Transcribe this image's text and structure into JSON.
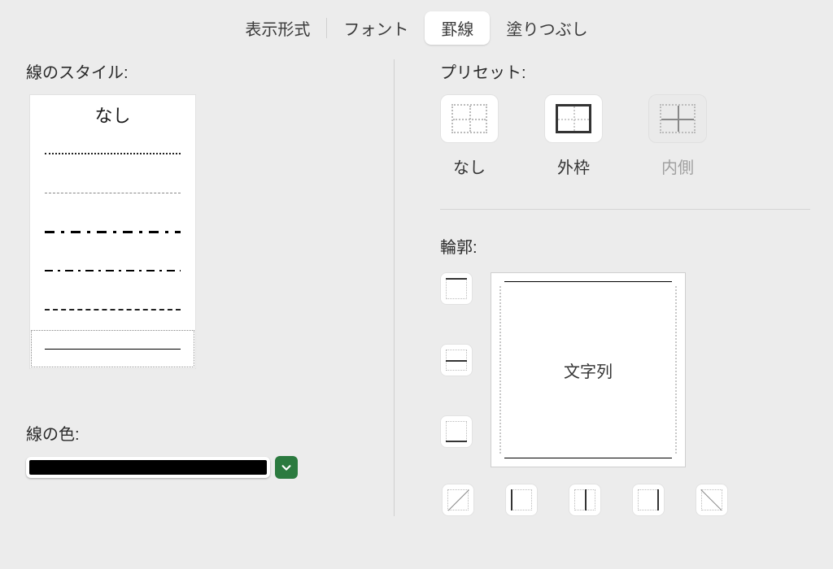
{
  "tabs": {
    "format": "表示形式",
    "font": "フォント",
    "border": "罫線",
    "fill": "塗りつぶし"
  },
  "left": {
    "style_label": "線のスタイル:",
    "none_option": "なし",
    "color_label": "線の色:",
    "color_value": "#000000"
  },
  "right": {
    "preset_label": "プリセット:",
    "presets": {
      "none": "なし",
      "outer": "外枠",
      "inner": "内側"
    },
    "outline_label": "輪郭:",
    "preview_text": "文字列"
  }
}
